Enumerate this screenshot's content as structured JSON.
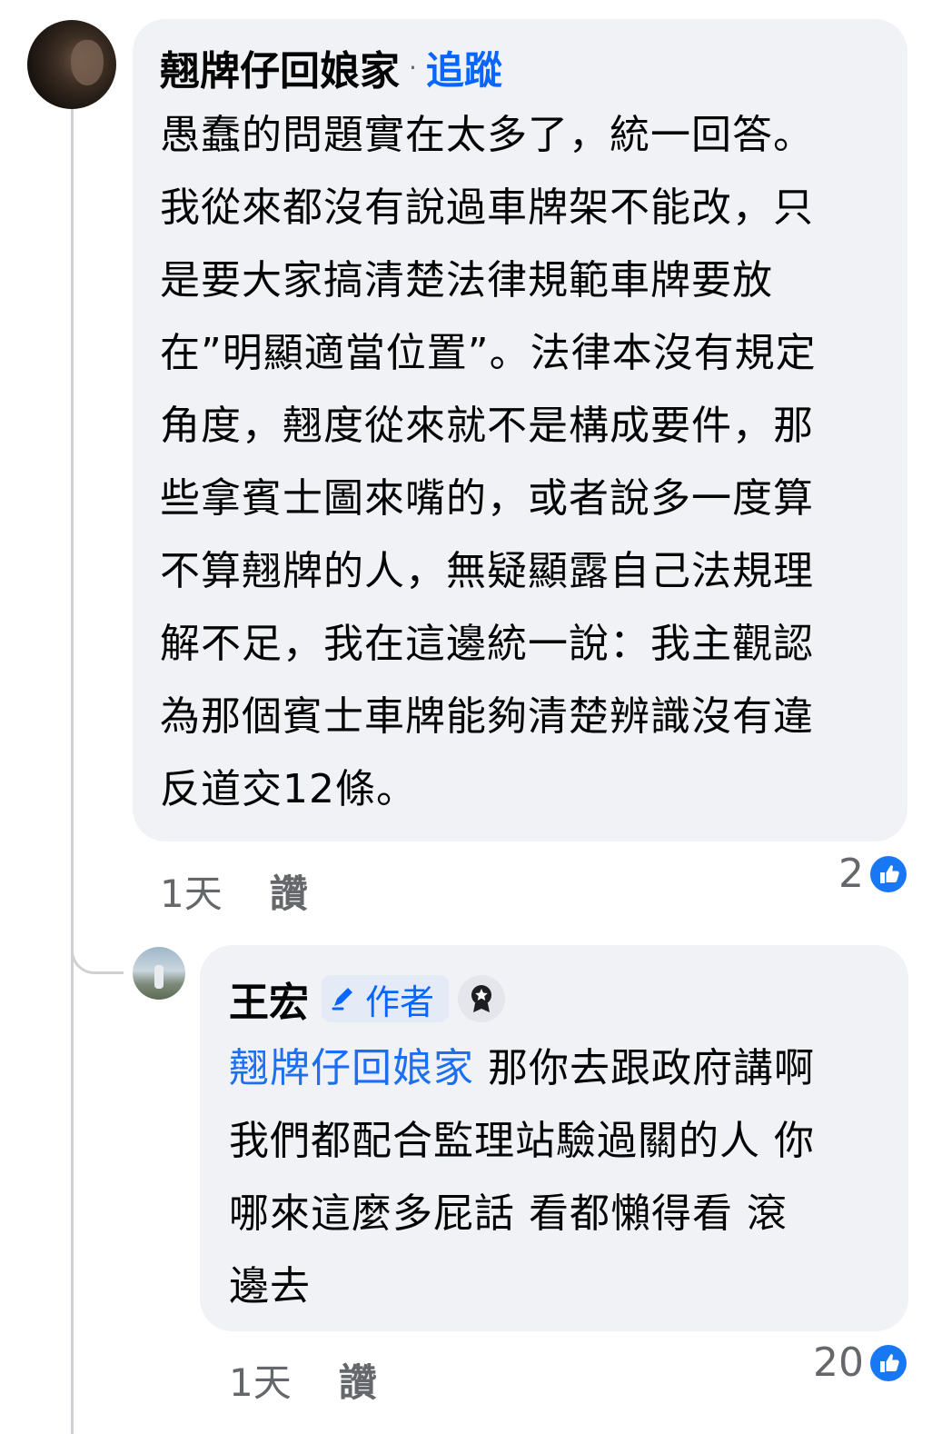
{
  "comment": {
    "author": "翹牌仔回娘家",
    "separator": "·",
    "follow_label": "追蹤",
    "lines": [
      "愚蠢的問題實在太多了，統一回答。",
      "我從來都沒有說過車牌架不能改，只",
      "是要大家搞清楚法律規範車牌要放",
      "在”明顯適當位置”。法律本沒有規定",
      "角度，翹度從來就不是構成要件，那",
      "些拿賓士圖來嘴的，或者說多一度算",
      "不算翹牌的人，無疑顯露自己法規理",
      "解不足，我在這邊統一說：我主觀認",
      "為那個賓士車牌能夠清楚辨識沒有違",
      "反道交12條。"
    ],
    "time": "1天",
    "like_label": "讚",
    "reaction_count": "2",
    "reaction_icon": "like-icon"
  },
  "reply": {
    "author": "王宏",
    "badge_label": "作者",
    "badge_icon": "pencil-icon",
    "fan_badge_icon": "top-fan-icon",
    "mention": "翹牌仔回娘家",
    "line1_rest": " 那你去跟政府講啊",
    "lines": [
      "我們都配合監理站驗過關的人 你",
      "哪來這麼多屁話 看都懶得看 滾",
      "邊去"
    ],
    "time": "1天",
    "like_label": "讚",
    "reaction_count": "20",
    "reaction_icon": "like-icon"
  },
  "colors": {
    "bubble": "#f0f2f5",
    "link_blue": "#0866ff",
    "muted": "#65676b"
  }
}
